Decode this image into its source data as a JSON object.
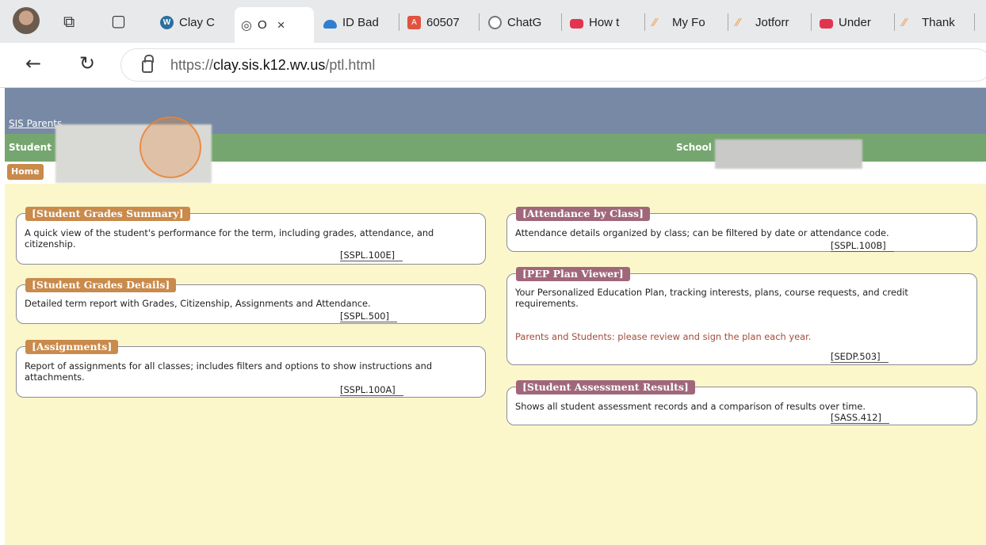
{
  "browser": {
    "tabs": [
      {
        "label": "Clay C",
        "icon": "wordpress-icon"
      },
      {
        "label": "O",
        "icon": "wifi-icon",
        "close": "×"
      },
      {
        "label": "ID Bad",
        "icon": "cloud-icon"
      },
      {
        "label": "60507",
        "icon": "pdf-icon"
      },
      {
        "label": "ChatG",
        "icon": "chatgpt-icon"
      },
      {
        "label": "How t",
        "icon": "video-icon"
      },
      {
        "label": "My Fo",
        "icon": "jotform-icon"
      },
      {
        "label": "Jotforr",
        "icon": "jotform-icon"
      },
      {
        "label": "Under",
        "icon": "video-icon"
      },
      {
        "label": "Thank",
        "icon": "jotform-icon"
      }
    ],
    "url_prefix": "https://",
    "url_host": "clay.sis.k12.wv.us",
    "url_path": "/ptl.html"
  },
  "page": {
    "top_link": "SIS Parents",
    "student_label": "Student",
    "school_label": "School",
    "home_button": "Home"
  },
  "left_cards": [
    {
      "title": "[Student Grades Summary]",
      "desc": "A quick view of the student's performance for the term, including grades, attendance, and citizenship.",
      "code": "[SSPL.100E]"
    },
    {
      "title": "[Student Grades Details]",
      "desc": "Detailed term report with Grades, Citizenship, Assignments and Attendance.",
      "code": "[SSPL.500]"
    },
    {
      "title": "[Assignments]",
      "desc": "Report of assignments for all classes; includes filters and options to show instructions and attachments.",
      "code": "[SSPL.100A]"
    }
  ],
  "right_cards": [
    {
      "title": "[Attendance by Class]",
      "desc": "Attendance details organized by class; can be filtered by date or attendance code.",
      "code": "[SSPL.100B]"
    },
    {
      "title": "[PEP Plan Viewer]",
      "desc": "Your Personalized Education Plan, tracking interests, plans, course requests, and credit requirements.",
      "note": "Parents and Students: please review and sign the plan each year.",
      "code": "[SEDP.503]"
    },
    {
      "title": "[Student Assessment Results]",
      "desc": "Shows all student assessment records and a comparison of results over time.",
      "code": "[SASS.412]"
    }
  ]
}
